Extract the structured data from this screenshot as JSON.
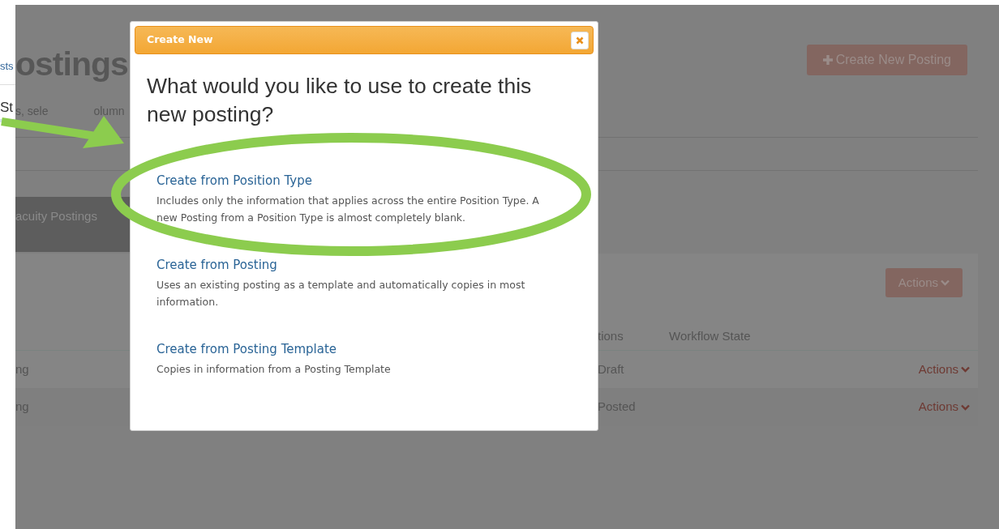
{
  "left_strip": {
    "link": "sts",
    "text": "St"
  },
  "page": {
    "heading": "ostings",
    "create_button": "Create New Posting",
    "subtitle": [
      "s, sele",
      "olumn"
    ],
    "tab": "acuity Postings",
    "actions_button": "Actions",
    "table": {
      "columns": [
        "tions",
        "Workflow State"
      ],
      "rows": [
        {
          "column_1": "ng",
          "workflow_state": "Draft",
          "actions": "Actions"
        },
        {
          "column_1": "ng",
          "workflow_state": "Posted",
          "actions": "Actions"
        }
      ]
    }
  },
  "modal": {
    "title": "Create New",
    "question": "What would you like to use to create this new posting?",
    "options": [
      {
        "title": "Create from Position Type",
        "description": "Includes only the information that applies across the entire Position Type. A new Posting from a Position Type is almost completely blank."
      },
      {
        "title": "Create from Posting",
        "description": "Uses an existing posting as a template and automatically copies in most information."
      },
      {
        "title": "Create from Posting Template",
        "description": "Copies in information from a Posting Template"
      }
    ]
  }
}
